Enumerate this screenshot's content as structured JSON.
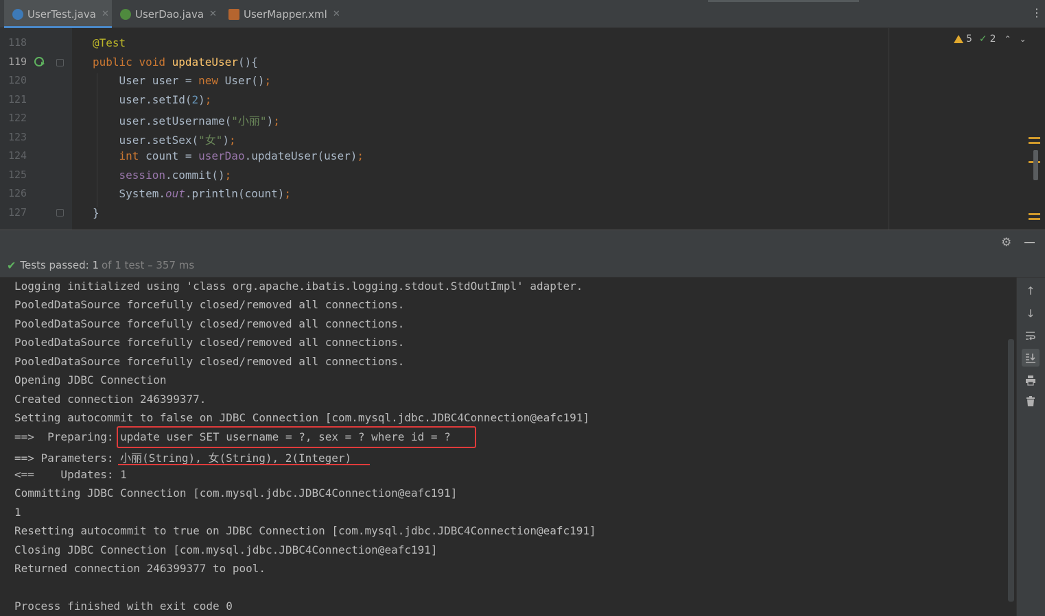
{
  "tabs": [
    {
      "label": "UserTest.java",
      "icon": "java-class-icon",
      "active": true
    },
    {
      "label": "UserDao.java",
      "icon": "java-interface-icon",
      "active": false
    },
    {
      "label": "UserMapper.xml",
      "icon": "xml-file-icon",
      "active": false
    }
  ],
  "editor": {
    "line_numbers": [
      "118",
      "119",
      "120",
      "121",
      "122",
      "123",
      "124",
      "125",
      "126",
      "127"
    ],
    "code_lines": [
      "@Test",
      "public void updateUser(){",
      "    User user = new User();",
      "    user.setId(2);",
      "    user.setUsername(\"小丽\");",
      "    user.setSex(\"女\");",
      "    int count = userDao.updateUser(user);",
      "    session.commit();",
      "    System.out.println(count);",
      "}"
    ],
    "inspections": {
      "warnings": "5",
      "weak_warnings": "2"
    }
  },
  "run": {
    "status_label": "Tests passed: 1",
    "status_detail": "of 1 test – 357 ms",
    "console_lines": [
      "Logging initialized using 'class org.apache.ibatis.logging.stdout.StdOutImpl' adapter.",
      "PooledDataSource forcefully closed/removed all connections.",
      "PooledDataSource forcefully closed/removed all connections.",
      "PooledDataSource forcefully closed/removed all connections.",
      "PooledDataSource forcefully closed/removed all connections.",
      "Opening JDBC Connection",
      "Created connection 246399377.",
      "Setting autocommit to false on JDBC Connection [com.mysql.jdbc.JDBC4Connection@eafc191]",
      "==>  Preparing: update user SET username = ?, sex = ? where id = ?",
      "==> Parameters: 小丽(String), 女(String), 2(Integer)",
      "<==    Updates: 1",
      "Committing JDBC Connection [com.mysql.jdbc.JDBC4Connection@eafc191]",
      "1",
      "Resetting autocommit to true on JDBC Connection [com.mysql.jdbc.JDBC4Connection@eafc191]",
      "Closing JDBC Connection [com.mysql.jdbc.JDBC4Connection@eafc191]",
      "Returned connection 246399377 to pool.",
      "",
      "Process finished with exit code 0"
    ]
  },
  "colors": {
    "accent": "#4a88c7",
    "highlight": "#e03b3b",
    "pass": "#5fb35f",
    "warning": "#e0a82e"
  }
}
